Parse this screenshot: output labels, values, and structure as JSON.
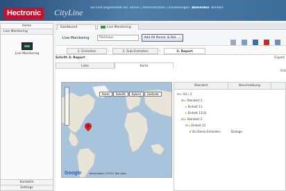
{
  "header": {
    "logo": "Hectronic",
    "app_name": "CityLine",
    "user_line": "Sie sind angemeldet als: admin | Administration | Einstellungen",
    "user_highlight1": "Abmelden",
    "user_highlight2": "Kontakt"
  },
  "sidebar": {
    "head": "Home",
    "sub": "Live Monitoring",
    "item": "Live Monitoring",
    "bottom": [
      "Kontakte",
      "Settings"
    ]
  },
  "tabs": [
    "Dashboard",
    "Live Monitoring"
  ],
  "toolbar": {
    "label": "Live Monitoring",
    "select_placeholder": "Parkhaus",
    "button": "Add All Parcel. & Del. ..."
  },
  "steps": [
    "1. Einheiten",
    "2. Sub-Einheiten",
    "3. Report"
  ],
  "sub_title": "Schritt 3: Report",
  "side_link": "Export",
  "subtabs": [
    "Liste",
    "Karte"
  ],
  "map": {
    "buttons": [
      "Karte",
      "Satellit",
      "Hybrid",
      "Gelände"
    ],
    "copyright": "Kartendaten ©2012 Tele Atlas",
    "google": "Google"
  },
  "grid": {
    "columns": [
      "Standort",
      "Beschreibung"
    ],
    "right_clip": "Stat",
    "rows": [
      {
        "indent": 1,
        "label": "CH / 3"
      },
      {
        "indent": 2,
        "label": "Standort 1"
      },
      {
        "indent": 3,
        "label": "Einheit 11"
      },
      {
        "indent": 3,
        "label": "Einheit 12(3)"
      },
      {
        "indent": 2,
        "label": "Standort 2"
      },
      {
        "indent": 3,
        "label": "Einheit 21"
      },
      {
        "indent": 4,
        "label": "Via Demo Einheiten",
        "desc": "Dialoge"
      }
    ]
  },
  "colors": {
    "header": "#3c6d98",
    "logo_bg": "#c8102e",
    "accent_green": "#2d8f4a"
  }
}
